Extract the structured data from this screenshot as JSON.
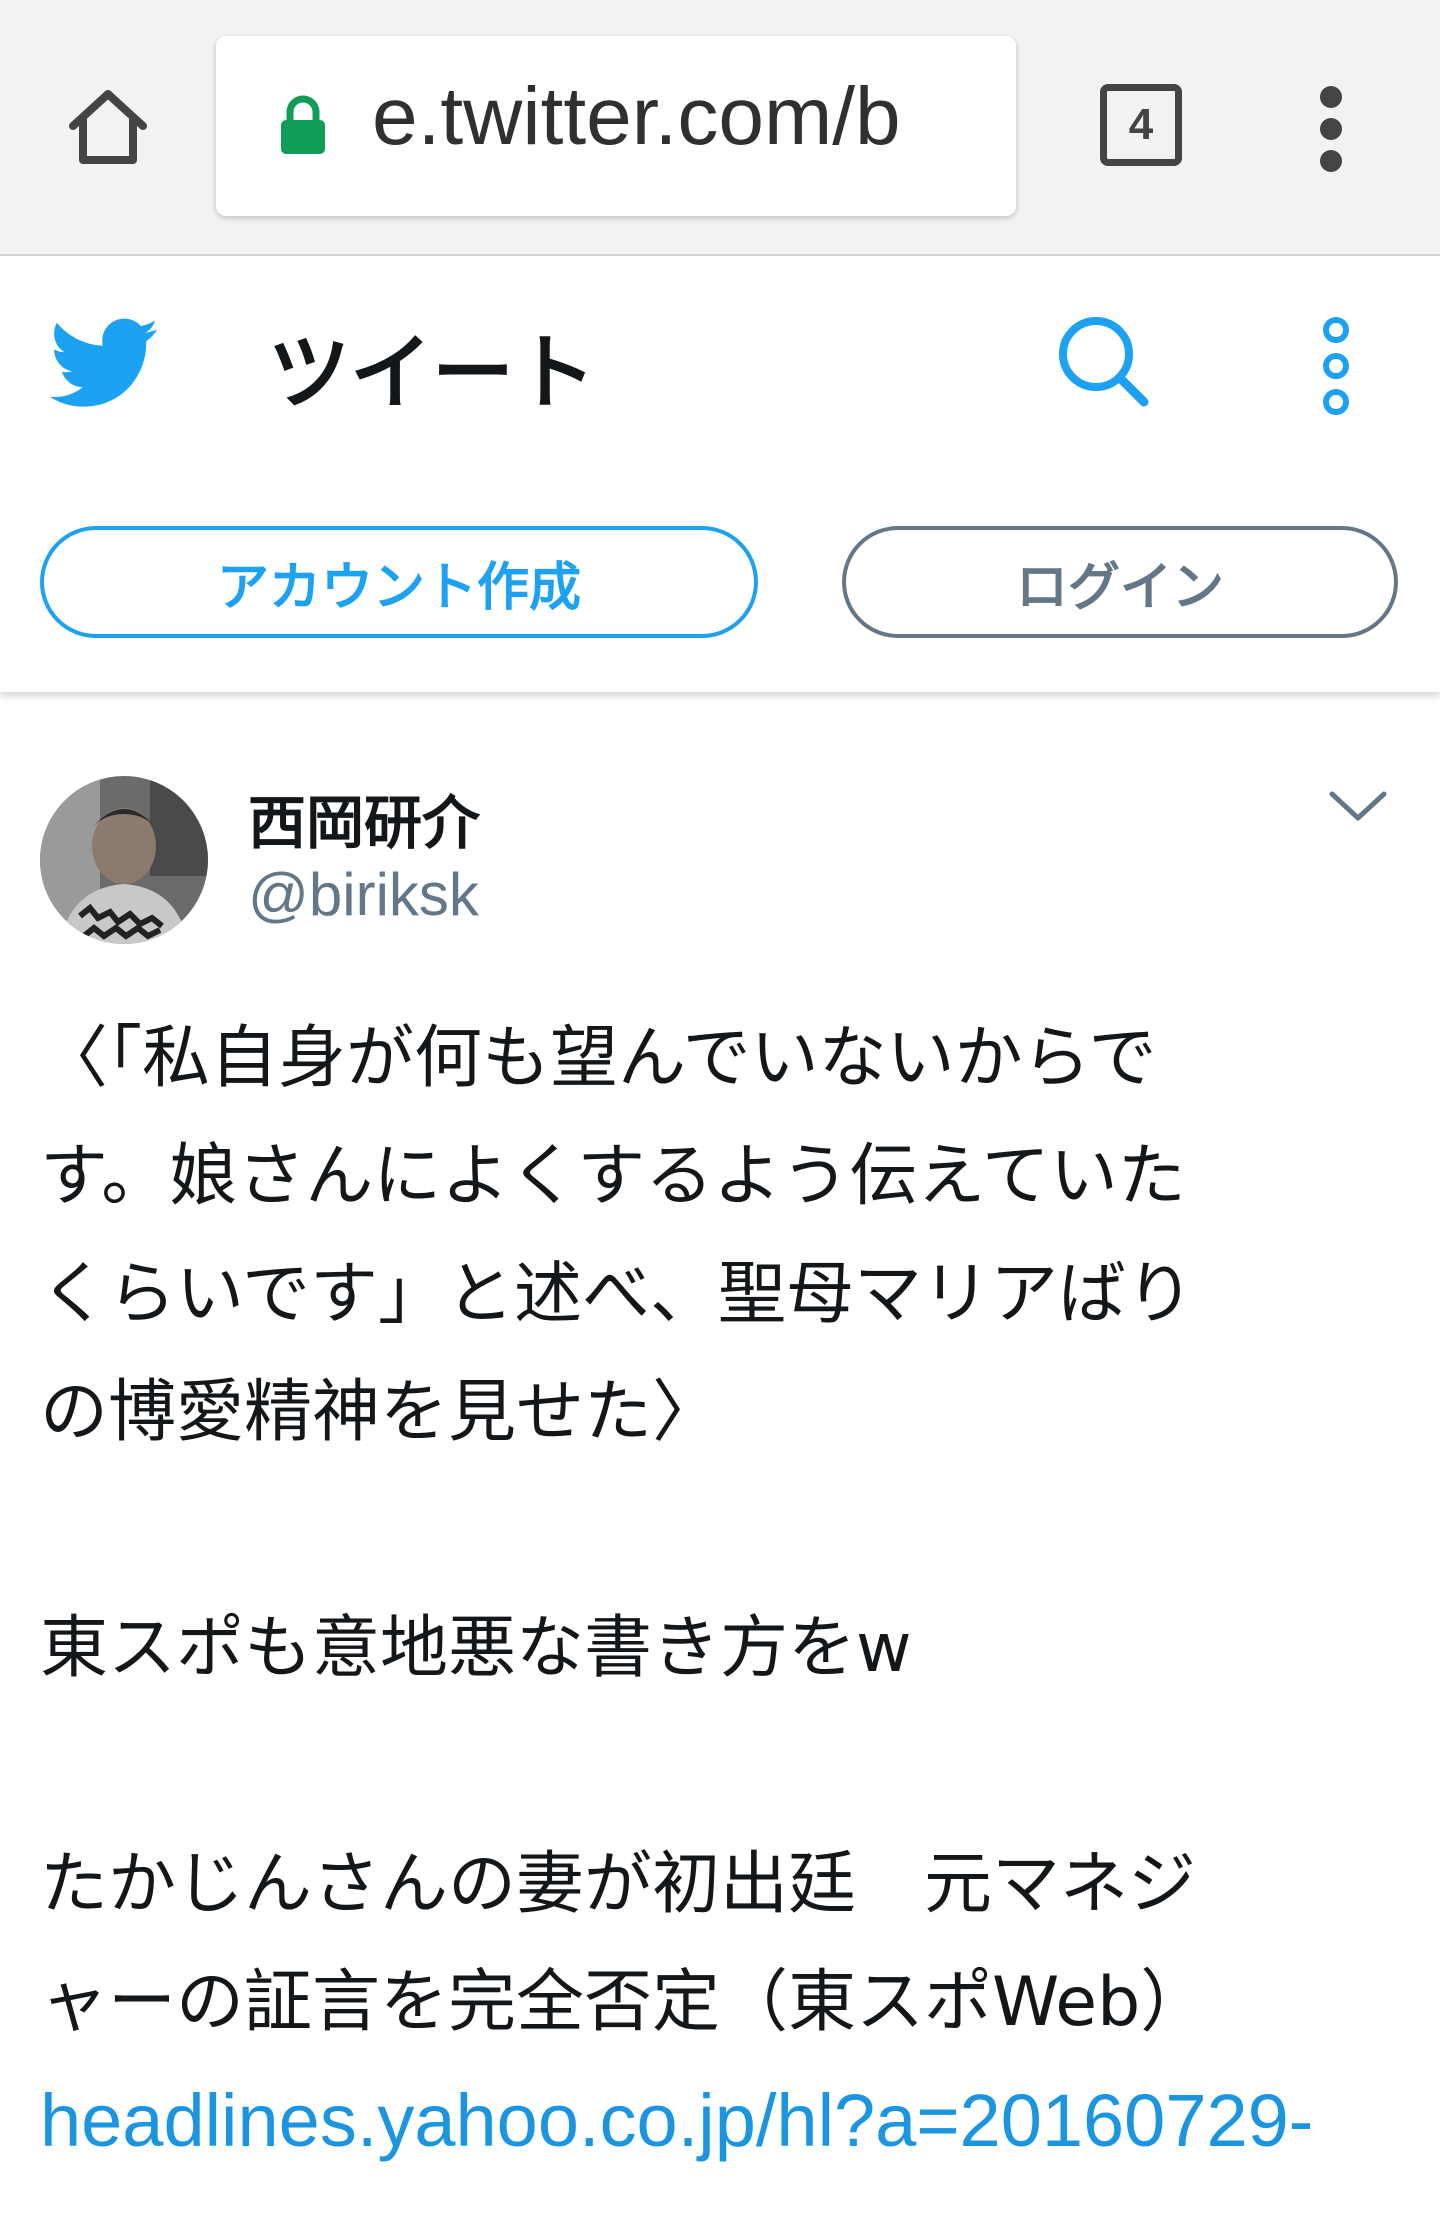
{
  "browser": {
    "url": "e.twitter.com/b",
    "tab_count": "4",
    "icons": [
      "home-icon",
      "lock-icon",
      "tabs-icon",
      "menu-icon"
    ]
  },
  "header": {
    "title": "ツイート",
    "signup_label": "アカウント作成",
    "login_label": "ログイン",
    "icons": [
      "twitter-bird-icon",
      "search-icon",
      "more-icon"
    ]
  },
  "tweet": {
    "name": "西岡研介",
    "handle": "@biriksk",
    "lines": [
      "〈「私自身が何も望んでいないからで",
      "す。娘さんによくするよう伝えていた",
      "くらいです」と述べ、聖母マリアばり",
      "の博愛精神を見せた〉"
    ],
    "comment": "東スポも意地悪な書き方をw",
    "headline_lines": [
      "たかじんさんの妻が初出廷　元マネジ",
      "ャーの証言を完全否定（東スポWeb）"
    ],
    "link": "headlines.yahoo.co.jp/hl?a=20160729-"
  },
  "colors": {
    "brand": "#1da1f2",
    "link": "#1b95e0",
    "secondary": "#657786",
    "text": "#14171a"
  }
}
